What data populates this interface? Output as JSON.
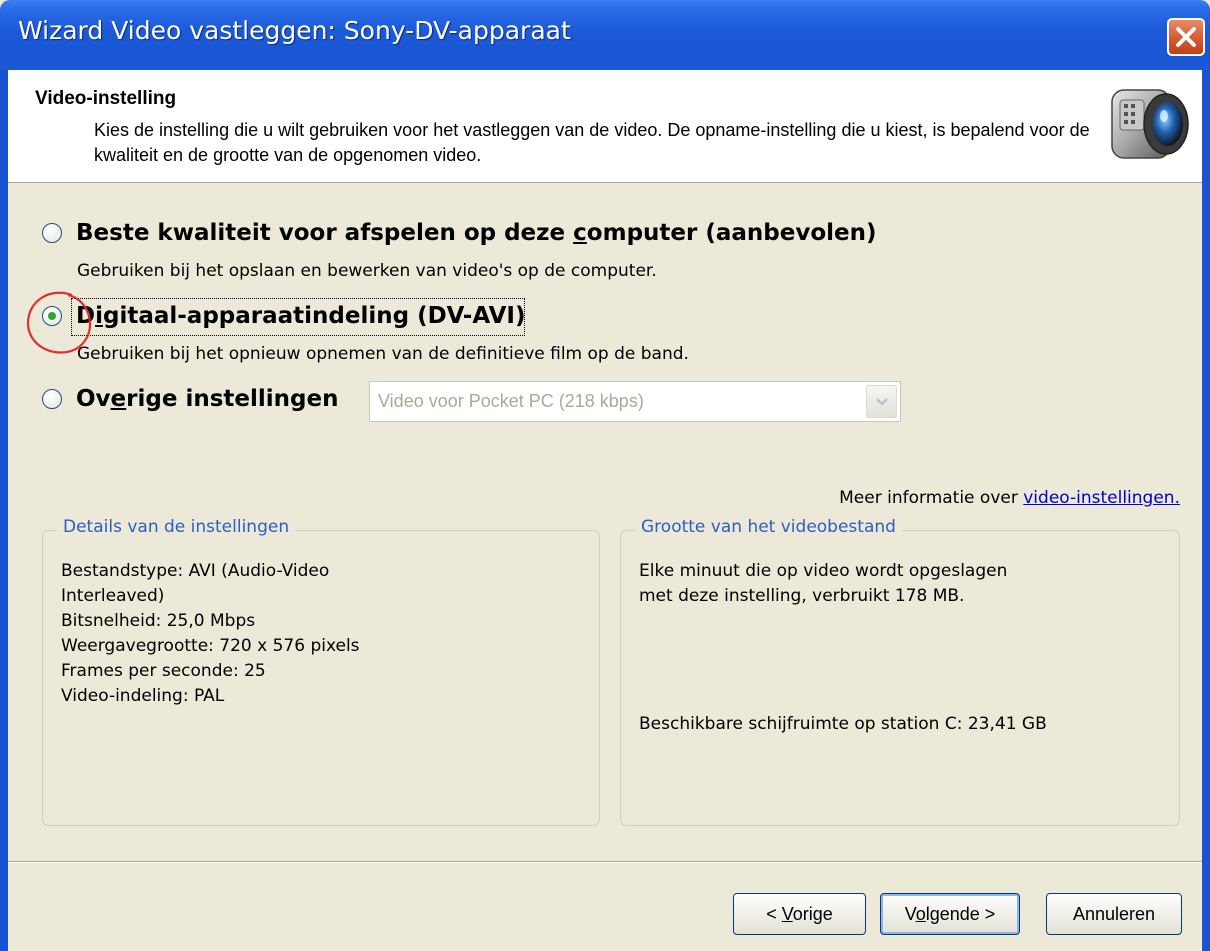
{
  "window": {
    "title": "Wizard Video vastleggen: Sony-DV-apparaat"
  },
  "header": {
    "title": "Video-instelling",
    "description": "Kies de instelling die u wilt gebruiken voor het vastleggen van de video. De opname-instelling die u kiest, is bepalend voor de kwaliteit en de grootte van de opgenomen video.",
    "icon": "camcorder-icon"
  },
  "options": [
    {
      "label_pre": "Beste kwaliteit voor afspelen op deze ",
      "label_accel": "c",
      "label_post": "omputer (aanbevolen)",
      "description": "Gebruiken bij het opslaan en bewerken van video's op de computer.",
      "selected": false
    },
    {
      "label_pre": "D",
      "label_accel": "i",
      "label_post": "gitaal-apparaatindeling (DV-AVI)",
      "description": "Gebruiken bij het opnieuw opnemen van de definitieve film op de band.",
      "selected": true
    },
    {
      "label_pre": "Ov",
      "label_accel": "e",
      "label_post": "rige instellingen",
      "selected": false
    }
  ],
  "other_settings_select": {
    "value": "Video voor Pocket PC (218 kbps)",
    "enabled": false
  },
  "more_info": {
    "text": "Meer informatie over ",
    "link": "video-instellingen."
  },
  "details_box": {
    "title": "Details van de instellingen",
    "lines": "Bestandstype: AVI (Audio-Video\nInterleaved)\nBitsnelheid: 25,0 Mbps\nWeergavegrootte: 720 x 576 pixels\nFrames per seconde: 25\nVideo-indeling: PAL"
  },
  "size_box": {
    "title": "Grootte van het videobestand",
    "text": "Elke minuut die op video wordt opgeslagen\nmet deze instelling, verbruikt 178 MB.",
    "free_space": "Beschikbare schijfruimte op station C: 23,41 GB"
  },
  "buttons": {
    "back_pre": "< ",
    "back_accel": "V",
    "back_post": "orige",
    "next_pre": "V",
    "next_accel": "o",
    "next_post": "lgende >",
    "cancel": "Annuleren"
  },
  "colors": {
    "titlebar": "#1c5ad8",
    "dialog_bg": "#ece9d8",
    "groupbox_title": "#2d5ec0",
    "link": "#0000cc",
    "annotation_circle": "#e0302c"
  }
}
